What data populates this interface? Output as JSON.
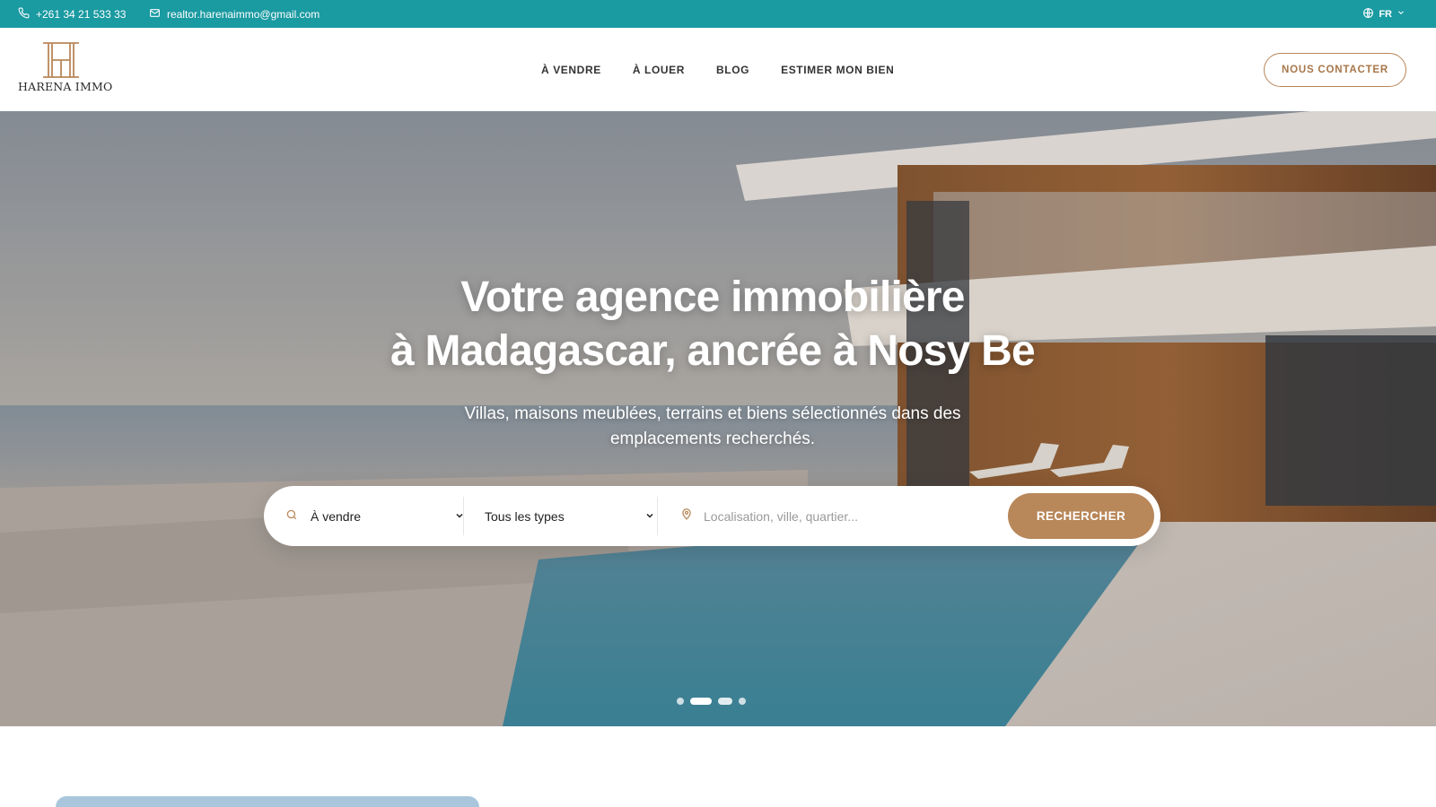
{
  "topbar": {
    "phone": "+261 34 21 533 33",
    "email": "realtor.harenaimmo@gmail.com",
    "language": "FR",
    "icons": {
      "phone": "phone-icon",
      "email": "mail-icon",
      "language": "globe-icon",
      "dropdown": "chevron-down-icon"
    },
    "background_color": "#1a9aa1"
  },
  "header": {
    "logo_text": "HARENA IMMO",
    "nav": [
      "À VENDRE",
      "À LOUER",
      "BLOG",
      "ESTIMER MON BIEN"
    ],
    "cta": "NOUS CONTACTER",
    "accent_color": "#b8875a"
  },
  "hero": {
    "title_line1": "Votre agence immobilière",
    "title_line2": "à Madagascar, ancrée à Nosy Be",
    "subtitle": "Villas, maisons meublées, terrains et biens sélectionnés dans des emplacements recherchés.",
    "search": {
      "transaction": "À vendre",
      "type": "Tous les types",
      "location_placeholder": "Localisation, ville, quartier...",
      "button": "RECHERCHER"
    },
    "slides": {
      "count": 4,
      "active": 2
    }
  }
}
